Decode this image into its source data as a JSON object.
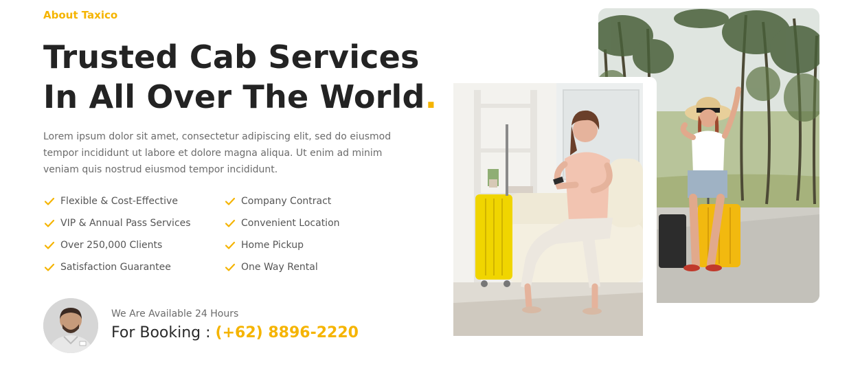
{
  "section": {
    "eyebrow": "About Taxico",
    "headline_line1": "Trusted Cab Services",
    "headline_line2": "In All Over The World",
    "headline_dot": ".",
    "description": "Lorem ipsum dolor sit amet, consectetur adipiscing elit, sed do eiusmod tempor incididunt ut labore et dolore magna aliqua. Ut enim ad minim veniam quis nostrud eiusmod tempor incididunt."
  },
  "features": [
    "Flexible & Cost-Effective",
    "Company Contract",
    "VIP & Annual Pass Services",
    "Convenient Location",
    "Over 250,000 Clients",
    "Home Pickup",
    "Satisfaction Guarantee",
    "One Way Rental"
  ],
  "booking": {
    "availability": "We Are Available 24 Hours",
    "label": "For Booking : ",
    "phone": "(+62) 8896-2220"
  },
  "icons": {
    "feature_icon": "check-icon",
    "avatar": "support-agent-avatar"
  },
  "colors": {
    "accent": "#f5b400",
    "heading": "#232323",
    "body_text": "#6b6b6b"
  }
}
